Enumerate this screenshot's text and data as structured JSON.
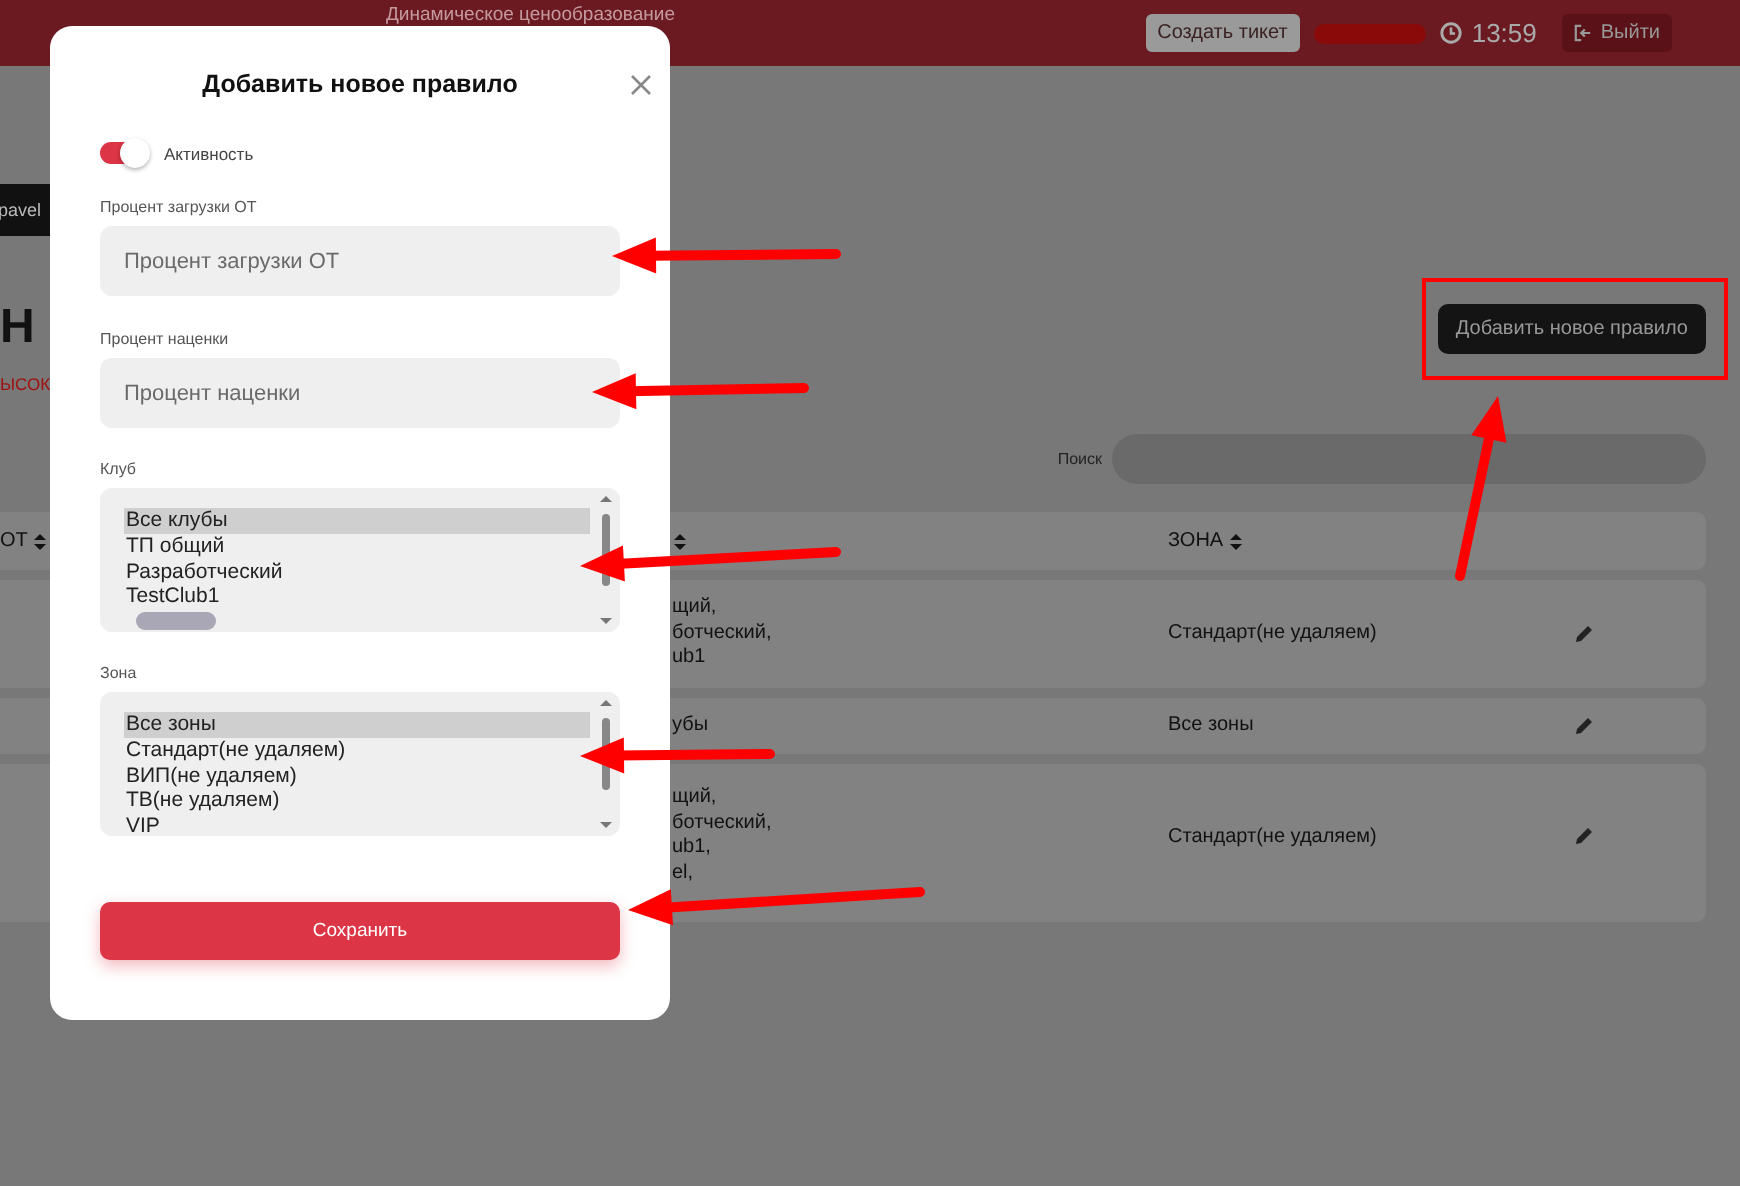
{
  "header": {
    "title": "Динамическое ценообразование",
    "ticket_button": "Создать тикет",
    "time": "13:59",
    "logout_button": "Выйти"
  },
  "page": {
    "user_tag": "pavel",
    "heading": "Н",
    "red_text": "ЫСОК",
    "add_button": "Добавить новое правило",
    "search_label": "Поиск"
  },
  "table": {
    "column_1": "ОТ",
    "zone_column": "ЗОНА",
    "rows": [
      {
        "clubs": [
          "щий,",
          "ботческий,",
          "ub1"
        ],
        "zone": "Стандарт(не удаляем)"
      },
      {
        "clubs": [
          "убы"
        ],
        "zone": "Все зоны"
      },
      {
        "clubs": [
          "щий,",
          "ботческий,",
          "ub1,",
          "el,"
        ],
        "zone": "Стандарт(не удаляем)"
      }
    ]
  },
  "modal": {
    "title": "Добавить новое правило",
    "active": {
      "label": "Активность",
      "on": true
    },
    "fields": [
      {
        "label": "Процент загрузки ОТ",
        "placeholder": "Процент загрузки ОТ"
      },
      {
        "label": "Процент наценки",
        "placeholder": "Процент наценки"
      }
    ],
    "lists": [
      {
        "label": "Клуб",
        "redacted_tail": true,
        "options": [
          {
            "label": "Все клубы",
            "selected": true
          },
          {
            "label": "ТП общий",
            "selected": false
          },
          {
            "label": "Разработческий",
            "selected": false
          },
          {
            "label": "TestClub1",
            "selected": false
          }
        ]
      },
      {
        "label": "Зона",
        "options": [
          {
            "label": "Все зоны",
            "selected": true
          },
          {
            "label": "Стандарт(не удаляем)",
            "selected": false
          },
          {
            "label": "ВИП(не удаляем)",
            "selected": false
          },
          {
            "label": "ТВ(не удаляем)",
            "selected": false
          },
          {
            "label": "VIP",
            "selected": false
          }
        ]
      }
    ],
    "save_button": "Сохранить"
  }
}
